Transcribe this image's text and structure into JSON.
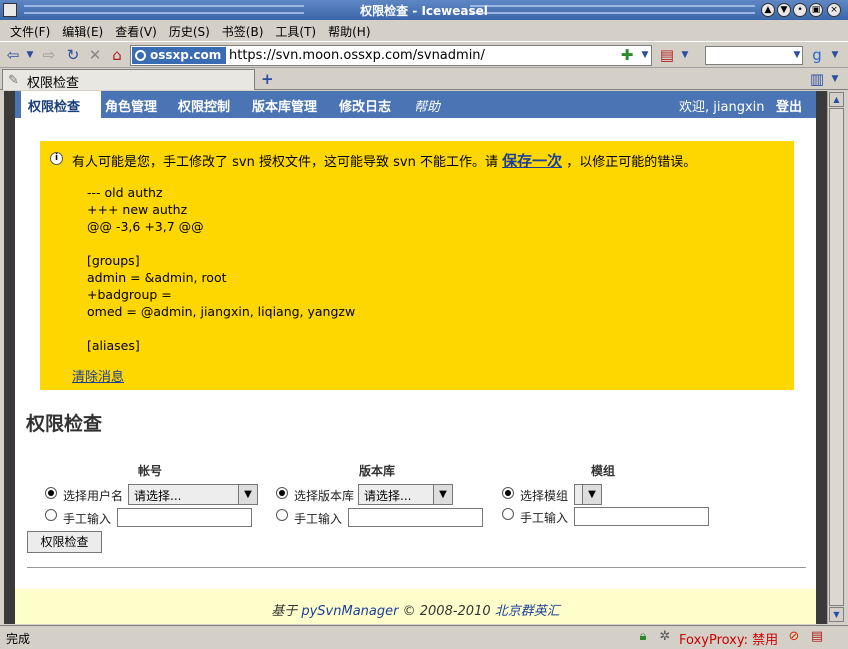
{
  "window": {
    "title": "权限检查 - Iceweasel"
  },
  "menubar": {
    "items": [
      "文件(F)",
      "编辑(E)",
      "查看(V)",
      "历史(S)",
      "书签(B)",
      "工具(T)",
      "帮助(H)"
    ]
  },
  "navbar": {
    "site_badge": "ossxp.com",
    "url": "https://svn.moon.ossxp.com/svnadmin/"
  },
  "tab": {
    "label": "权限检查",
    "new_tab": "+"
  },
  "app_nav": {
    "items": [
      "权限检查",
      "角色管理",
      "权限控制",
      "版本库管理",
      "修改日志",
      "帮助"
    ],
    "active_index": 0,
    "welcome": "欢迎, jiangxin",
    "logout": "登出"
  },
  "message": {
    "text_before": "有人可能是您，手工修改了 svn 授权文件，这可能导致 svn 不能工作。请",
    "save_link": "保存一次",
    "text_after": "，以修正可能的错误。",
    "diff": "--- old authz\n+++ new authz\n@@ -3,6 +3,7 @@\n\n[groups]\nadmin = &admin, root\n+badgroup =\nomed = @admin, jiangxin, liqiang, yangzw\n\n[aliases]",
    "clear_link": "清除消息"
  },
  "form": {
    "heading": "权限检查",
    "columns": [
      {
        "header": "帐号",
        "select_label": "选择用户名",
        "select_value": "请选择...",
        "manual_label": "手工输入"
      },
      {
        "header": "版本库",
        "select_label": "选择版本库",
        "select_value": "请选择...",
        "manual_label": "手工输入"
      },
      {
        "header": "模组",
        "select_label": "选择模组",
        "select_value": "",
        "manual_label": "手工输入"
      }
    ],
    "submit": "权限检查"
  },
  "footer": {
    "prefix": "基于",
    "product": "pySvnManager",
    "copyright": "© 2008-2010",
    "company": "北京群英汇"
  },
  "statusbar": {
    "text": "完成",
    "foxyproxy": "FoxyProxy: 禁用"
  },
  "colors": {
    "nav_blue": "#4a74b3",
    "message_yellow": "#ffd700",
    "footer_yellow": "#ffffcc",
    "link_blue": "#1a3f9a"
  }
}
